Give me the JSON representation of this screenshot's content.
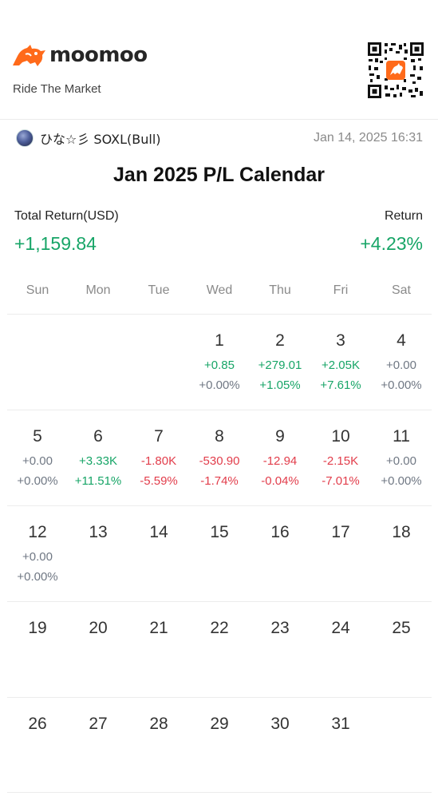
{
  "brand": {
    "name": "moomoo",
    "tagline": "Ride The Market"
  },
  "user": {
    "name": "ひな☆彡 SOXL(Bull)",
    "timestamp": "Jan 14, 2025 16:31"
  },
  "calendar_title": "Jan 2025 P/L Calendar",
  "summary": {
    "total_return_label": "Total Return(USD)",
    "total_return_value": "+1,159.84",
    "return_label": "Return",
    "return_value": "+4.23%"
  },
  "weekdays": [
    "Sun",
    "Mon",
    "Tue",
    "Wed",
    "Thu",
    "Fri",
    "Sat"
  ],
  "weeks": [
    [
      {
        "day": "",
        "pl": "",
        "pct": "",
        "sign": ""
      },
      {
        "day": "",
        "pl": "",
        "pct": "",
        "sign": ""
      },
      {
        "day": "",
        "pl": "",
        "pct": "",
        "sign": ""
      },
      {
        "day": "1",
        "pl": "+0.85",
        "pct": "+0.00%",
        "sign": "pos",
        "pct_sign": "zero"
      },
      {
        "day": "2",
        "pl": "+279.01",
        "pct": "+1.05%",
        "sign": "pos",
        "pct_sign": "pos"
      },
      {
        "day": "3",
        "pl": "+2.05K",
        "pct": "+7.61%",
        "sign": "pos",
        "pct_sign": "pos"
      },
      {
        "day": "4",
        "pl": "+0.00",
        "pct": "+0.00%",
        "sign": "zero",
        "pct_sign": "zero"
      }
    ],
    [
      {
        "day": "5",
        "pl": "+0.00",
        "pct": "+0.00%",
        "sign": "zero",
        "pct_sign": "zero"
      },
      {
        "day": "6",
        "pl": "+3.33K",
        "pct": "+11.51%",
        "sign": "pos",
        "pct_sign": "pos"
      },
      {
        "day": "7",
        "pl": "-1.80K",
        "pct": "-5.59%",
        "sign": "neg",
        "pct_sign": "neg"
      },
      {
        "day": "8",
        "pl": "-530.90",
        "pct": "-1.74%",
        "sign": "neg",
        "pct_sign": "neg"
      },
      {
        "day": "9",
        "pl": "-12.94",
        "pct": "-0.04%",
        "sign": "neg",
        "pct_sign": "neg"
      },
      {
        "day": "10",
        "pl": "-2.15K",
        "pct": "-7.01%",
        "sign": "neg",
        "pct_sign": "neg"
      },
      {
        "day": "11",
        "pl": "+0.00",
        "pct": "+0.00%",
        "sign": "zero",
        "pct_sign": "zero"
      }
    ],
    [
      {
        "day": "12",
        "pl": "+0.00",
        "pct": "+0.00%",
        "sign": "zero",
        "pct_sign": "zero"
      },
      {
        "day": "13",
        "pl": "",
        "pct": "",
        "sign": ""
      },
      {
        "day": "14",
        "pl": "",
        "pct": "",
        "sign": ""
      },
      {
        "day": "15",
        "pl": "",
        "pct": "",
        "sign": ""
      },
      {
        "day": "16",
        "pl": "",
        "pct": "",
        "sign": ""
      },
      {
        "day": "17",
        "pl": "",
        "pct": "",
        "sign": ""
      },
      {
        "day": "18",
        "pl": "",
        "pct": "",
        "sign": ""
      }
    ],
    [
      {
        "day": "19",
        "pl": "",
        "pct": "",
        "sign": ""
      },
      {
        "day": "20",
        "pl": "",
        "pct": "",
        "sign": ""
      },
      {
        "day": "21",
        "pl": "",
        "pct": "",
        "sign": ""
      },
      {
        "day": "22",
        "pl": "",
        "pct": "",
        "sign": ""
      },
      {
        "day": "23",
        "pl": "",
        "pct": "",
        "sign": ""
      },
      {
        "day": "24",
        "pl": "",
        "pct": "",
        "sign": ""
      },
      {
        "day": "25",
        "pl": "",
        "pct": "",
        "sign": ""
      }
    ],
    [
      {
        "day": "26",
        "pl": "",
        "pct": "",
        "sign": ""
      },
      {
        "day": "27",
        "pl": "",
        "pct": "",
        "sign": ""
      },
      {
        "day": "28",
        "pl": "",
        "pct": "",
        "sign": ""
      },
      {
        "day": "29",
        "pl": "",
        "pct": "",
        "sign": ""
      },
      {
        "day": "30",
        "pl": "",
        "pct": "",
        "sign": ""
      },
      {
        "day": "31",
        "pl": "",
        "pct": "",
        "sign": ""
      },
      {
        "day": "",
        "pl": "",
        "pct": "",
        "sign": ""
      }
    ]
  ],
  "colors": {
    "brand_orange": "#ff6a1a",
    "positive": "#17a567",
    "negative": "#e23d4b",
    "neutral": "#707884"
  },
  "icons": {
    "logo": "moomoo-bull-logo-icon",
    "qr": "qr-code-icon",
    "avatar": "user-avatar"
  }
}
